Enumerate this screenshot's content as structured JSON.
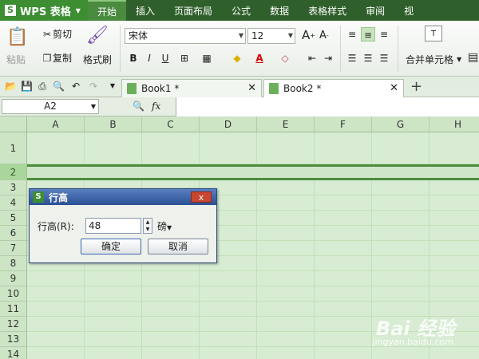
{
  "app_menu": {
    "title": "WPS 表格",
    "logo": "S"
  },
  "menu": [
    "开始",
    "插入",
    "页面布局",
    "公式",
    "数据",
    "表格样式",
    "审阅",
    "视"
  ],
  "ribbon": {
    "paste": "粘贴",
    "cut": "剪切",
    "copy": "复制",
    "format_painter": "格式刷",
    "font_name": "宋体",
    "font_size": "12",
    "merge_cells": "合并单元格",
    "grow_font": "A",
    "shrink_font": "A",
    "bold": "B",
    "italic": "I",
    "underline": "U",
    "font_color": "A",
    "sup": "+",
    "sub": "-"
  },
  "tabs": [
    {
      "label": "Book1 *"
    },
    {
      "label": "Book2 *"
    }
  ],
  "formula_bar": {
    "cell_ref": "A2",
    "fx": "fx"
  },
  "columns": [
    "A",
    "B",
    "C",
    "D",
    "E",
    "F",
    "G",
    "H"
  ],
  "rows": [
    "1",
    "2",
    "3",
    "4",
    "5",
    "6",
    "7",
    "8",
    "9",
    "10",
    "11",
    "12",
    "13",
    "14"
  ],
  "dialog": {
    "title": "行高",
    "label": "行高(R):",
    "value": "48",
    "unit": "磅",
    "ok": "确定",
    "cancel": "取消",
    "close": "x"
  },
  "watermark": {
    "brand": "Bai 经验",
    "sub": "jingyan.baidu.com"
  }
}
